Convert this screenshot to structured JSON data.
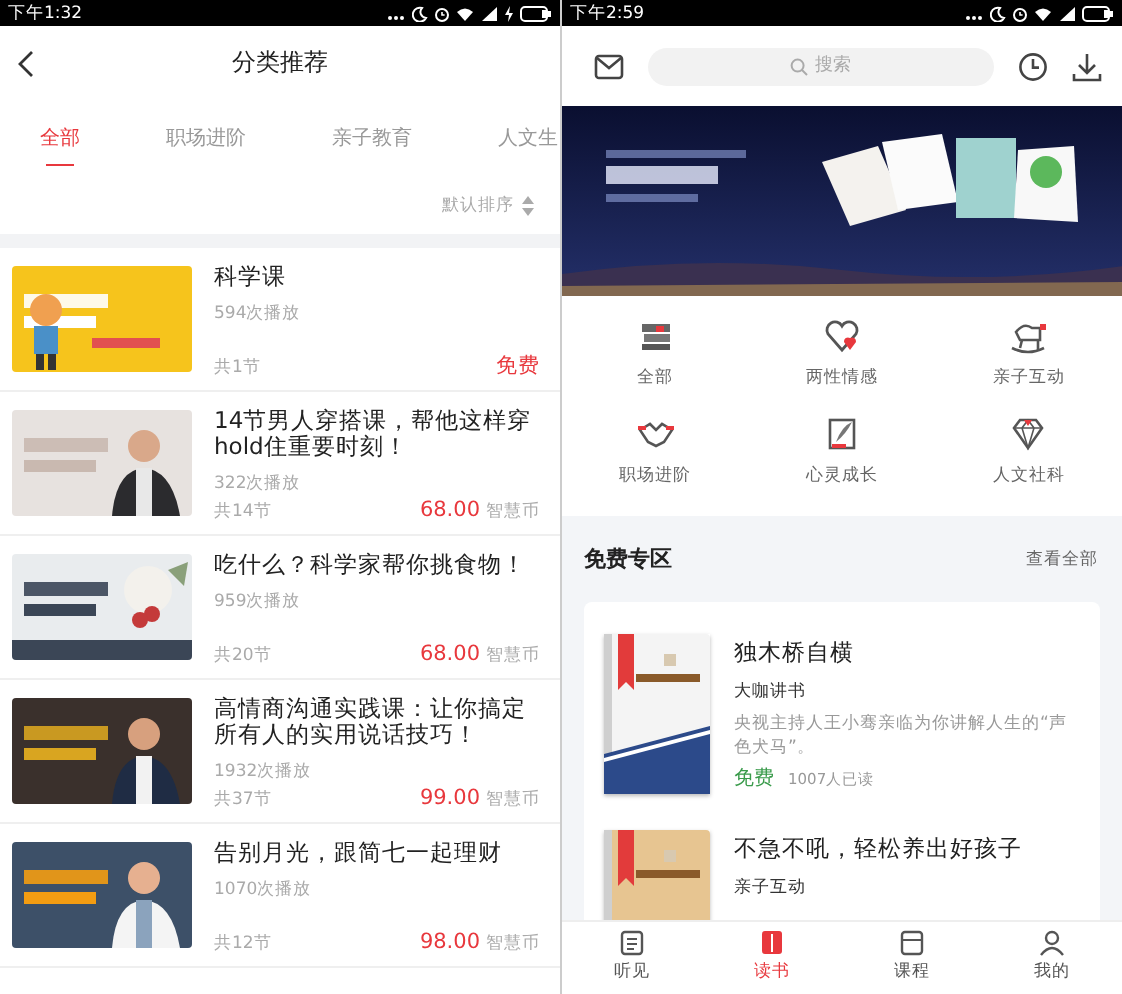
{
  "left": {
    "status_bar": {
      "time": "下午1:32"
    },
    "title": "分类推荐",
    "tabs": [
      {
        "label": "全部",
        "selected": true
      },
      {
        "label": "职场进阶",
        "selected": false
      },
      {
        "label": "亲子教育",
        "selected": false
      },
      {
        "label": "人文生",
        "selected": false
      }
    ],
    "sort": "默认排序",
    "courses": [
      {
        "title": "科学课",
        "plays": "594次播放",
        "lessons": "共1节",
        "price": "免费"
      },
      {
        "title": "14节男人穿搭课，帮他这样穿hold住重要时刻！",
        "plays": "322次播放",
        "lessons": "共14节",
        "price": "68.00",
        "unit": "智慧币"
      },
      {
        "title": "吃什么？科学家帮你挑食物！",
        "plays": "959次播放",
        "lessons": "共20节",
        "price": "68.00",
        "unit": "智慧币"
      },
      {
        "title": "高情商沟通实践课：让你搞定所有人的实用说话技巧！",
        "plays": "1932次播放",
        "lessons": "共37节",
        "price": "99.00",
        "unit": "智慧币"
      },
      {
        "title": "告别月光，跟简七一起理财",
        "plays": "1070次播放",
        "lessons": "共12节",
        "price": "98.00",
        "unit": "智慧币"
      }
    ]
  },
  "right": {
    "status_bar": {
      "time": "下午2:59"
    },
    "search": {
      "placeholder": "搜索"
    },
    "categories": [
      {
        "label": "全部"
      },
      {
        "label": "两性情感"
      },
      {
        "label": "亲子互动"
      },
      {
        "label": "职场进阶"
      },
      {
        "label": "心灵成长"
      },
      {
        "label": "人文社科"
      }
    ],
    "free_zone": {
      "title": "免费专区",
      "more": "查看全部",
      "books": [
        {
          "title": "独木桥自横",
          "category": "大咖讲书",
          "description": "央视主持人王小骞亲临为你讲解人生的“声色犬马”。",
          "price": "免费",
          "readers": "1007人已读"
        },
        {
          "title": "不急不吼，轻松养出好孩子",
          "category": "亲子互动"
        }
      ]
    },
    "bottom_tabs": [
      {
        "label": "听见",
        "selected": false
      },
      {
        "label": "读书",
        "selected": true
      },
      {
        "label": "课程",
        "selected": false
      },
      {
        "label": "我的",
        "selected": false
      }
    ]
  }
}
